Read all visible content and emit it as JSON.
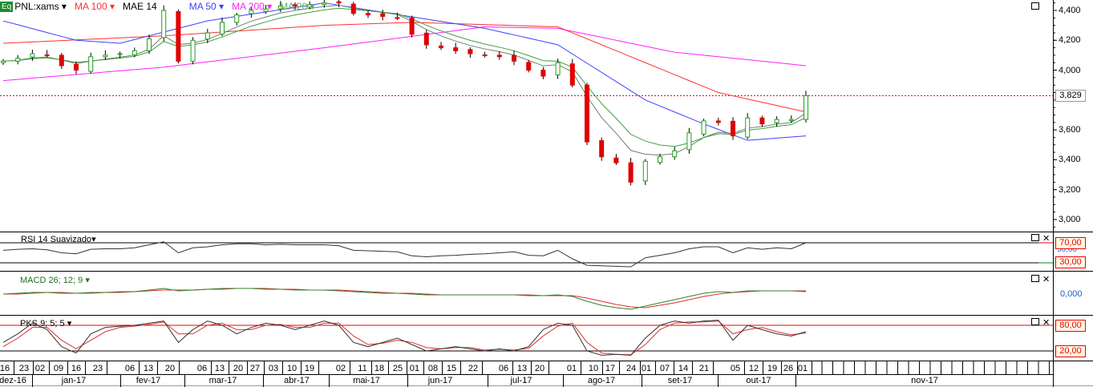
{
  "legend": {
    "eq_label": "Eq",
    "symbol": "PNL:xams",
    "ma100": "MA 100",
    "mae14": "MAE 14",
    "ma50": "MA 50",
    "ma200": "MA 200",
    "ma20": "MA 20"
  },
  "price_axis": {
    "ticks": [
      "4,400",
      "4,200",
      "4,000",
      "3,600",
      "3,400",
      "3,200",
      "3,000"
    ],
    "last_price": "3,829"
  },
  "panels": {
    "rsi": {
      "title": "RSI 14 Suavizado",
      "upper": "70,00",
      "mid": "50,00",
      "lower": "30,00"
    },
    "macd": {
      "title": "MACD 26; 12; 9",
      "zero": "0,000"
    },
    "pks": {
      "title": "PKS 9; 5; 5",
      "upper": "80,00",
      "lower": "20,00"
    }
  },
  "date_axis": {
    "days": [
      "16",
      "23",
      "02",
      "09",
      "16",
      "23",
      "06",
      "13",
      "20",
      "06",
      "13",
      "20",
      "27",
      "03",
      "10",
      "19",
      "02",
      "11",
      "18",
      "25",
      "01",
      "08",
      "15",
      "22",
      "06",
      "13",
      "20",
      "01",
      "10",
      "17",
      "24",
      "01",
      "07",
      "14",
      "21",
      "05",
      "12",
      "19",
      "26",
      "01"
    ],
    "months": [
      "dez-16",
      "jan-17",
      "fev-17",
      "mar-17",
      "abr-17",
      "mai-17",
      "jun-17",
      "jul-17",
      "ago-17",
      "set-17",
      "out-17",
      "nov-17"
    ]
  },
  "colors": {
    "ma100": "#ff3030",
    "ma50": "#4040ff",
    "ma200": "#ff20ff",
    "mae14": "#708070",
    "ma20": "#40a040",
    "up": "#20a020",
    "down": "#e00000",
    "last": "#e00000"
  },
  "chart_data": {
    "type": "candlestick",
    "close": [
      4060,
      4080,
      4110,
      4100,
      4030,
      4000,
      4090,
      4100,
      4110,
      4130,
      4210,
      4400,
      4060,
      4200,
      4250,
      4320,
      4370,
      4400,
      4410,
      4430,
      4430,
      4440,
      4450,
      4450,
      4380,
      4370,
      4360,
      4350,
      4240,
      4170,
      4150,
      4130,
      4110,
      4100,
      4090,
      4060,
      4000,
      3960,
      4050,
      3900,
      3520,
      3420,
      3380,
      3250,
      3390,
      3420,
      3460,
      3580,
      3660,
      3650,
      3560,
      3680,
      3640,
      3670,
      3670,
      3829
    ],
    "ma100": [
      [
        0,
        4180
      ],
      [
        11,
        4230
      ],
      [
        22,
        4300
      ],
      [
        28,
        4320
      ],
      [
        38,
        4290
      ],
      [
        44,
        4050
      ],
      [
        49,
        3850
      ],
      [
        55,
        3720
      ]
    ],
    "ma50": [
      [
        0,
        4330
      ],
      [
        5,
        4200
      ],
      [
        8,
        4180
      ],
      [
        14,
        4330
      ],
      [
        22,
        4450
      ],
      [
        33,
        4280
      ],
      [
        38,
        4170
      ],
      [
        44,
        3800
      ],
      [
        48,
        3640
      ],
      [
        51,
        3530
      ],
      [
        55,
        3560
      ]
    ],
    "ma200": [
      [
        0,
        3930
      ],
      [
        11,
        4020
      ],
      [
        22,
        4150
      ],
      [
        33,
        4290
      ],
      [
        38,
        4280
      ],
      [
        46,
        4120
      ],
      [
        55,
        4030
      ]
    ],
    "rsi": [
      55,
      57,
      58,
      56,
      50,
      48,
      57,
      58,
      58,
      60,
      66,
      72,
      50,
      60,
      62,
      66,
      68,
      68,
      66,
      67,
      66,
      66,
      66,
      64,
      55,
      54,
      53,
      52,
      44,
      42,
      44,
      45,
      47,
      48,
      50,
      52,
      45,
      44,
      55,
      38,
      25,
      24,
      23,
      22,
      40,
      45,
      50,
      58,
      62,
      62,
      50,
      60,
      57,
      60,
      58,
      70
    ],
    "macd": [
      -0.01,
      0,
      0.01,
      0.01,
      0,
      0,
      0.01,
      0.01,
      0.02,
      0.02,
      0.04,
      0.06,
      0.03,
      0.04,
      0.05,
      0.06,
      0.06,
      0.06,
      0.05,
      0.05,
      0.04,
      0.04,
      0.04,
      0.03,
      0.02,
      0.01,
      0,
      0,
      -0.01,
      -0.02,
      -0.02,
      -0.02,
      -0.02,
      -0.02,
      -0.02,
      -0.02,
      -0.03,
      -0.03,
      -0.02,
      -0.04,
      -0.1,
      -0.15,
      -0.18,
      -0.2,
      -0.16,
      -0.12,
      -0.08,
      -0.04,
      0,
      0.02,
      0.01,
      0.03,
      0.03,
      0.03,
      0.03,
      0.02
    ],
    "signal": [
      -0.01,
      -0.01,
      0,
      0.01,
      0.01,
      0,
      0,
      0.01,
      0.01,
      0.02,
      0.03,
      0.04,
      0.04,
      0.04,
      0.05,
      0.05,
      0.06,
      0.06,
      0.06,
      0.05,
      0.05,
      0.04,
      0.04,
      0.04,
      0.03,
      0.02,
      0.01,
      0,
      0,
      -0.01,
      -0.02,
      -0.02,
      -0.02,
      -0.02,
      -0.02,
      -0.02,
      -0.02,
      -0.03,
      -0.03,
      -0.03,
      -0.06,
      -0.1,
      -0.14,
      -0.17,
      -0.18,
      -0.15,
      -0.12,
      -0.08,
      -0.04,
      -0.01,
      0.01,
      0.02,
      0.03,
      0.03,
      0.03,
      0.03
    ],
    "pks": [
      40,
      60,
      85,
      70,
      30,
      15,
      60,
      75,
      78,
      80,
      85,
      90,
      40,
      70,
      90,
      80,
      60,
      75,
      85,
      80,
      70,
      80,
      90,
      80,
      40,
      30,
      40,
      50,
      35,
      20,
      25,
      30,
      25,
      20,
      25,
      20,
      30,
      70,
      85,
      80,
      20,
      10,
      12,
      10,
      50,
      80,
      90,
      85,
      90,
      92,
      45,
      80,
      70,
      60,
      55,
      65
    ],
    "pks_signal": [
      30,
      50,
      75,
      75,
      45,
      25,
      45,
      65,
      75,
      78,
      82,
      88,
      60,
      60,
      80,
      85,
      70,
      70,
      80,
      82,
      75,
      75,
      85,
      85,
      55,
      35,
      38,
      45,
      40,
      28,
      25,
      28,
      28,
      22,
      24,
      22,
      26,
      55,
      78,
      85,
      40,
      15,
      12,
      11,
      35,
      70,
      85,
      88,
      88,
      90,
      60,
      70,
      75,
      65,
      58,
      62
    ]
  }
}
